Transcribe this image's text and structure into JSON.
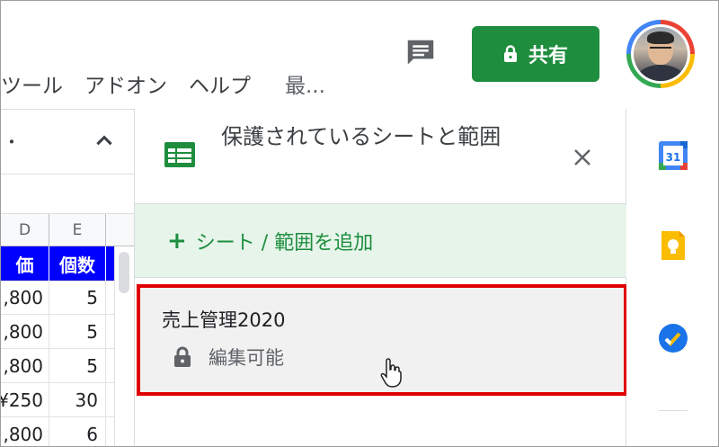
{
  "menu": {
    "items": [
      "ツール",
      "アドオン",
      "ヘルプ",
      "最..."
    ]
  },
  "header": {
    "share_label": "共有",
    "share_color": "#1e8e3e"
  },
  "sheet": {
    "dot": "・",
    "columns": [
      "D",
      "E"
    ],
    "header_row": [
      "価",
      "個数"
    ],
    "rows": [
      [
        ",800",
        "5"
      ],
      [
        ",800",
        "5"
      ],
      [
        ",800",
        "5"
      ],
      [
        "¥250",
        "30"
      ],
      [
        ",800",
        "6"
      ]
    ]
  },
  "panel": {
    "title": "保護されているシートと範囲",
    "add_label": "シート / 範囲を追加",
    "item": {
      "name": "売上管理2020",
      "permission": "編集可能"
    }
  },
  "sidebar": {
    "calendar_day": "31"
  },
  "colors": {
    "accent_green": "#1e8e3e",
    "highlight_red": "#e00000",
    "header_blue": "#0000ff"
  }
}
